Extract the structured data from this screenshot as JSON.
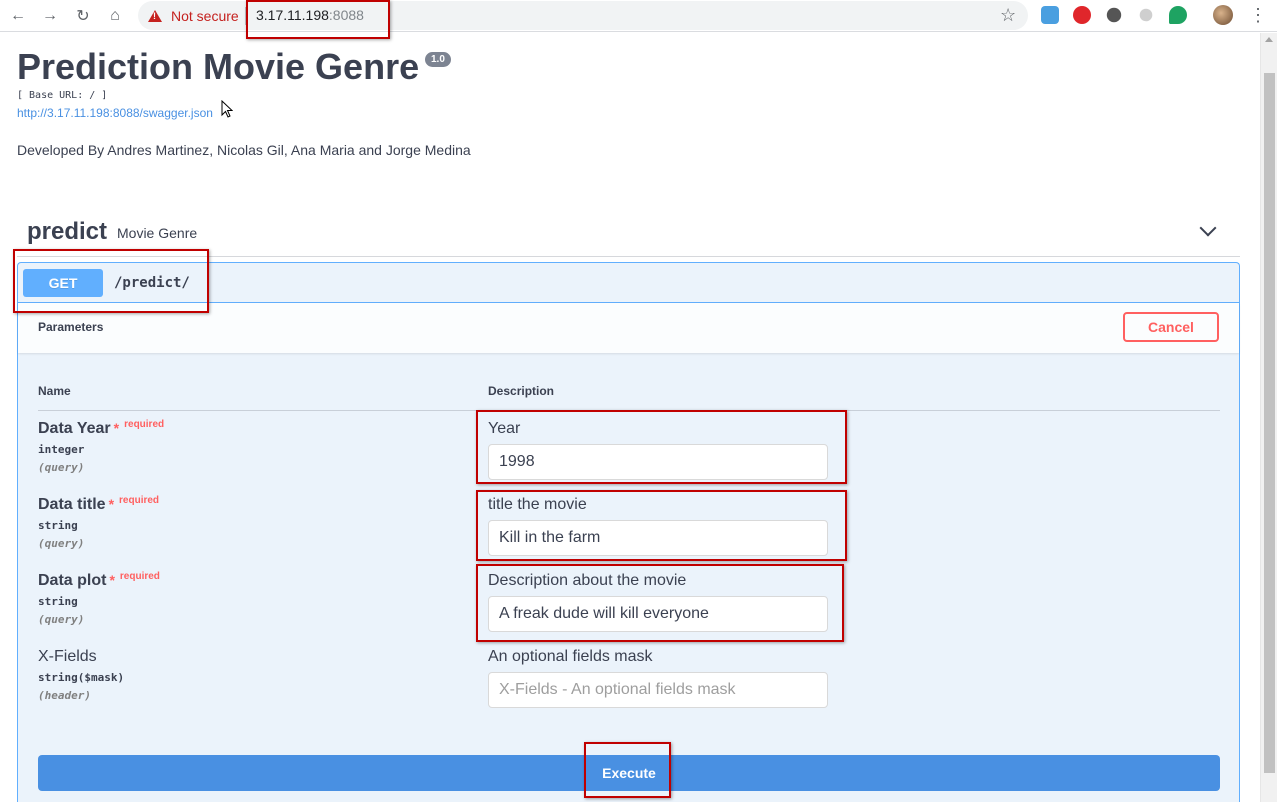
{
  "browser": {
    "security_label": "Not secure",
    "url_host": "3.17.11.198",
    "url_port": ":8088"
  },
  "page": {
    "title": "Prediction Movie Genre",
    "version": "1.0",
    "base_url": "[ Base URL: / ]",
    "spec_link": "http://3.17.11.198:8088/swagger.json",
    "description": "Developed By Andres Martinez, Nicolas Gil, Ana Maria and Jorge Medina"
  },
  "tag": {
    "name": "predict",
    "description": "Movie Genre"
  },
  "operation": {
    "method": "GET",
    "path": "/predict/",
    "parameters_title": "Parameters",
    "cancel_label": "Cancel",
    "col_name": "Name",
    "col_description": "Description",
    "execute_label": "Execute"
  },
  "params": [
    {
      "name": "Data Year",
      "required_star": "*",
      "required_text": "required",
      "type": "integer",
      "in": "(query)",
      "description": "Year",
      "value": "1998",
      "placeholder": ""
    },
    {
      "name": "Data title",
      "required_star": "*",
      "required_text": "required",
      "type": "string",
      "in": "(query)",
      "description": "title the movie",
      "value": "Kill in the farm",
      "placeholder": ""
    },
    {
      "name": "Data plot",
      "required_star": "*",
      "required_text": "required",
      "type": "string",
      "in": "(query)",
      "description": "Description about the movie",
      "value": "A freak dude will kill everyone",
      "placeholder": ""
    },
    {
      "name": "X-Fields",
      "type": "string($mask)",
      "in": "(header)",
      "description": "An optional fields mask",
      "value": "",
      "placeholder": "X-Fields - An optional fields mask"
    }
  ],
  "colors": {
    "get_blue": "#61affe",
    "execute_blue": "#4990e2",
    "cancel_red": "#ff6060",
    "annotation_red": "#c00000"
  }
}
